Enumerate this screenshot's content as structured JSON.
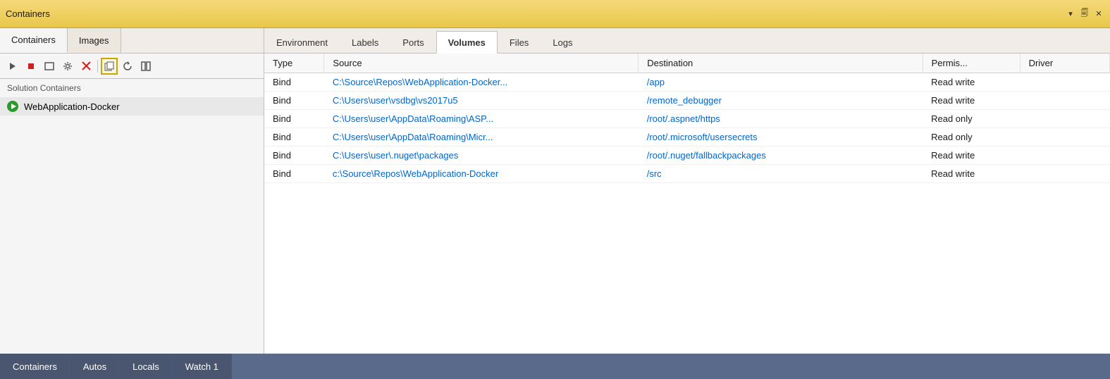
{
  "titlebar": {
    "title": "Containers",
    "controls": {
      "dropdown": "▾",
      "pin": "📌",
      "close": "✕"
    }
  },
  "left": {
    "tabs": [
      {
        "id": "containers",
        "label": "Containers",
        "active": true
      },
      {
        "id": "images",
        "label": "Images",
        "active": false
      }
    ],
    "toolbar": {
      "buttons": [
        {
          "id": "start",
          "icon": "▶",
          "label": "Start"
        },
        {
          "id": "stop",
          "icon": "■",
          "label": "Stop"
        },
        {
          "id": "terminal",
          "icon": "⬜",
          "label": "Terminal"
        },
        {
          "id": "settings",
          "icon": "⚙",
          "label": "Settings"
        },
        {
          "id": "delete",
          "icon": "✕",
          "label": "Delete"
        },
        {
          "id": "copy",
          "icon": "⧉",
          "label": "Copy",
          "active": true
        },
        {
          "id": "refresh",
          "icon": "↻",
          "label": "Refresh"
        },
        {
          "id": "pause",
          "icon": "⊡",
          "label": "Pause"
        }
      ]
    },
    "solution_header": "Solution Containers",
    "containers": [
      {
        "id": "web-app-docker",
        "name": "WebApplication-Docker",
        "status": "running"
      }
    ]
  },
  "right": {
    "tabs": [
      {
        "id": "environment",
        "label": "Environment",
        "active": false
      },
      {
        "id": "labels",
        "label": "Labels",
        "active": false
      },
      {
        "id": "ports",
        "label": "Ports",
        "active": false
      },
      {
        "id": "volumes",
        "label": "Volumes",
        "active": true
      },
      {
        "id": "files",
        "label": "Files",
        "active": false
      },
      {
        "id": "logs",
        "label": "Logs",
        "active": false
      }
    ],
    "table": {
      "columns": [
        {
          "id": "type",
          "label": "Type"
        },
        {
          "id": "source",
          "label": "Source"
        },
        {
          "id": "destination",
          "label": "Destination"
        },
        {
          "id": "permissions",
          "label": "Permis..."
        },
        {
          "id": "driver",
          "label": "Driver"
        }
      ],
      "rows": [
        {
          "type": "Bind",
          "source": "C:\\Source\\Repos\\WebApplication-Docker...",
          "destination": "/app",
          "permissions": "Read write",
          "driver": ""
        },
        {
          "type": "Bind",
          "source": "C:\\Users\\user\\vsdbg\\vs2017u5",
          "destination": "/remote_debugger",
          "permissions": "Read write",
          "driver": ""
        },
        {
          "type": "Bind",
          "source": "C:\\Users\\user\\AppData\\Roaming\\ASP...",
          "destination": "/root/.aspnet/https",
          "permissions": "Read only",
          "driver": ""
        },
        {
          "type": "Bind",
          "source": "C:\\Users\\user\\AppData\\Roaming\\Micr...",
          "destination": "/root/.microsoft/usersecrets",
          "permissions": "Read only",
          "driver": ""
        },
        {
          "type": "Bind",
          "source": "C:\\Users\\user\\.nuget\\packages",
          "destination": "/root/.nuget/fallbackpackages",
          "permissions": "Read write",
          "driver": ""
        },
        {
          "type": "Bind",
          "source": "c:\\Source\\Repos\\WebApplication-Docker",
          "destination": "/src",
          "permissions": "Read write",
          "driver": ""
        }
      ]
    }
  },
  "bottom": {
    "tabs": [
      {
        "id": "containers-bottom",
        "label": "Containers",
        "active": false
      },
      {
        "id": "autos",
        "label": "Autos",
        "active": false
      },
      {
        "id": "locals",
        "label": "Locals",
        "active": false
      },
      {
        "id": "watch1",
        "label": "Watch 1",
        "active": true
      }
    ]
  }
}
